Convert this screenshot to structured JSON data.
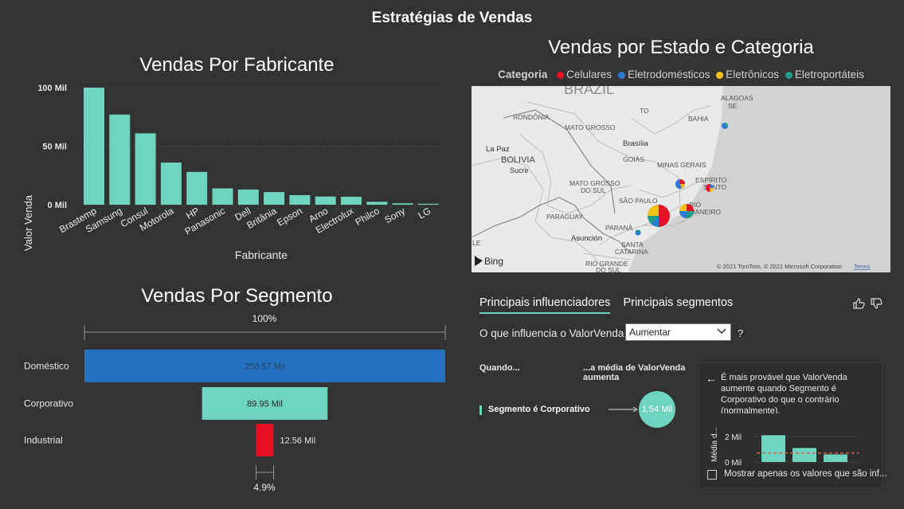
{
  "page": {
    "title": "Estratégias de Vendas"
  },
  "chart_data": [
    {
      "type": "bar",
      "title": "Vendas Por Fabricante",
      "xlabel": "Fabricante",
      "ylabel": "Valor Venda",
      "categories": [
        "Brastemp",
        "Samsung",
        "Consul",
        "Motorola",
        "HP",
        "Panasonic",
        "Dell",
        "Britânia",
        "Epson",
        "Arno",
        "Electrolux",
        "Philco",
        "Sony",
        "LG"
      ],
      "values": [
        100000,
        77000,
        61000,
        36000,
        28000,
        14000,
        13000,
        10800,
        8200,
        7000,
        6800,
        2500,
        1200,
        800
      ],
      "yticks": [
        "0 Mil",
        "50 Mil",
        "100 Mil"
      ],
      "ylim": [
        0,
        100000
      ],
      "color": "#6ed3bf"
    },
    {
      "type": "bar",
      "title": "Vendas Por Segmento",
      "categories": [
        "Doméstico",
        "Corporativo",
        "Industrial"
      ],
      "values": [
        258.57,
        89.95,
        12.56
      ],
      "labels": [
        "258.57 Mil",
        "89.95 Mil",
        "12.56 Mil"
      ],
      "colors": [
        "#2671bd",
        "#6ed3bf",
        "#e81123"
      ],
      "top_pct": "100%",
      "bottom_pct": "4.9%"
    }
  ],
  "map": {
    "title": "Vendas por Estado e Categoria",
    "legend_title": "Categoria",
    "legend": [
      {
        "label": "Celulares",
        "color": "#e81123"
      },
      {
        "label": "Eletrodomésticos",
        "color": "#2b7cd3"
      },
      {
        "label": "Eletrônicos",
        "color": "#f2c314"
      },
      {
        "label": "Eletroportáteis",
        "color": "#1e9e87"
      }
    ],
    "labels": {
      "brazil": "BRAZIL",
      "alagoas": "ALAGOAS",
      "se": "SE",
      "to": "TO",
      "bahia": "BAHIA",
      "rondonia": "RONDÔNIA",
      "mato_grosso": "MATO GROSSO",
      "brasilia": "Brasília",
      "lapaz": "La Paz",
      "bolivia": "BOLIVIA",
      "sucre": "Sucre",
      "goias": "GOIÁS",
      "minas": "MINAS GERAIS",
      "es1": "ESPÍRITO",
      "es2": "SANTO",
      "mts1": "MATO GROSSO",
      "mts2": "DO SUL",
      "sp": "SÃO PAULO",
      "rj1": "RIO",
      "rj2": "DE JANEIRO",
      "paraguay": "PARAGUAY",
      "parana": "PARANÁ",
      "asuncion": "Asunción",
      "sc1": "SANTA",
      "sc2": "CATARINA",
      "rs1": "RIO GRANDE",
      "rs2": "DO SUL",
      "le": "LE"
    },
    "attribution": "© 2021 TomTom, © 2021 Microsoft Corporation",
    "terms": "Terms",
    "provider": "Bing"
  },
  "influencers": {
    "tab_active": "Principais influenciadores",
    "tab_other": "Principais segmentos",
    "question": "O que influencia o ValorVenda a",
    "dropdown_value": "Aumentar",
    "help": "?",
    "when_label": "Quando...",
    "avg_label": "...a média de ValorVenda aumenta",
    "factor": "Segmento é Corporativo",
    "bubble_value": "1.54 Mil",
    "explanation": "É mais provável que ValorVenda aumente quando Segmento é Corporativo do que o contrário (normalmente).",
    "mini_ylabel": "Média d...",
    "mini_yticks": [
      "0 Mil",
      "2 Mil"
    ],
    "mini_values": [
      2.1,
      1.1,
      0.6
    ],
    "mini_average": 0.7,
    "checkbox_label": "Mostrar apenas os valores que são inf..."
  }
}
